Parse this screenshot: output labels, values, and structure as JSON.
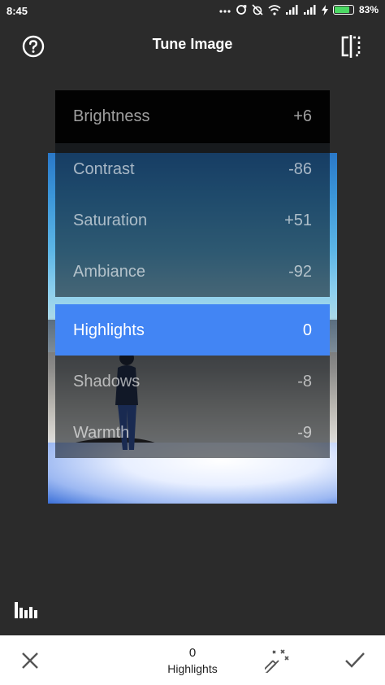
{
  "status_bar": {
    "time": "8:45",
    "battery_percent": "83%",
    "battery_level": 0.83,
    "battery_color": "#4cd964",
    "icons": [
      "more-dots-icon",
      "sync-icon",
      "alarm-off-icon",
      "wifi-icon",
      "signal-icon",
      "signal-icon",
      "charging-icon",
      "battery-icon"
    ]
  },
  "header": {
    "title": "Tune Image",
    "left_icon": "help-icon",
    "right_icon": "compare-icon"
  },
  "adjustments": {
    "items": [
      {
        "label": "Brightness",
        "value": "+6"
      },
      {
        "label": "Contrast",
        "value": "-86"
      },
      {
        "label": "Saturation",
        "value": "+51"
      },
      {
        "label": "Ambiance",
        "value": "-92"
      },
      {
        "label": "Highlights",
        "value": "0"
      },
      {
        "label": "Shadows",
        "value": "-8"
      },
      {
        "label": "Warmth",
        "value": "-9"
      }
    ],
    "selected": "Highlights",
    "accent_color": "#4285f4"
  },
  "toolbar": {
    "histogram_icon": "histogram-icon"
  },
  "bottom_bar": {
    "cancel_icon": "close-icon",
    "current_value": "0",
    "current_param": "Highlights",
    "auto_icon": "magic-wand-icon",
    "apply_icon": "check-icon"
  }
}
